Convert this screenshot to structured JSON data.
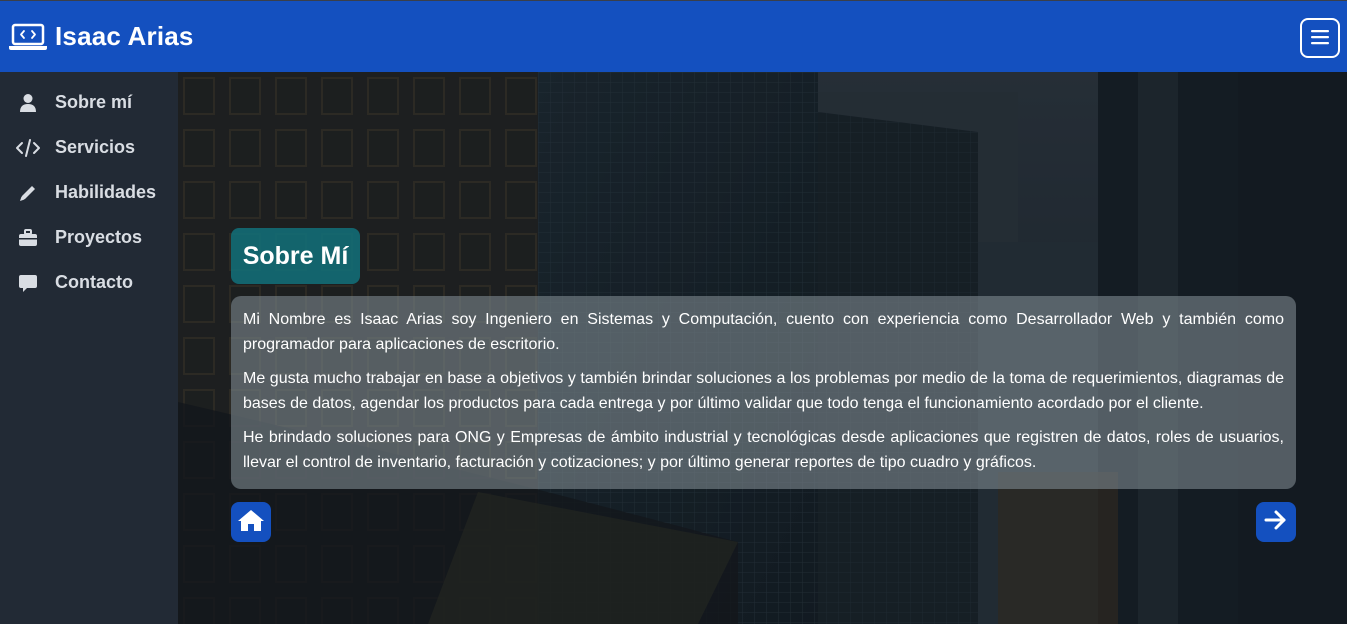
{
  "header": {
    "brand": "Isaac Arias",
    "brand_icon": "laptop-code-icon",
    "menu_icon": "hamburger-menu-icon"
  },
  "sidebar": {
    "items": [
      {
        "label": "Sobre mí",
        "icon": "user-icon"
      },
      {
        "label": "Servicios",
        "icon": "code-icon"
      },
      {
        "label": "Habilidades",
        "icon": "pencil-icon"
      },
      {
        "label": "Proyectos",
        "icon": "briefcase-icon"
      },
      {
        "label": "Contacto",
        "icon": "comment-icon"
      }
    ]
  },
  "main": {
    "title": "Sobre Mí",
    "paragraphs": [
      "Mi Nombre es Isaac Arias soy Ingeniero en Sistemas y Computación, cuento con experiencia como Desarrollador Web y también como programador para aplicaciones de escritorio.",
      "Me gusta mucho trabajar en base a objetivos y también brindar soluciones a los problemas por medio de la toma de requerimientos, diagramas de bases de datos, agendar los productos para cada entrega y por último validar que todo tenga el funcionamiento acordado por el cliente.",
      "He brindado soluciones para ONG y Empresas de ámbito industrial y tecnológicas desde aplicaciones que registren de datos, roles de usuarios, llevar el control de inventario, facturación y cotizaciones; y por último generar reportes de tipo cuadro y gráficos."
    ],
    "home_icon": "home-icon",
    "next_icon": "arrow-right-icon"
  },
  "colors": {
    "header_bg": "#1450bf",
    "sidebar_bg": "#222a35",
    "title_bg": "#126e78",
    "button_bg": "#1450bf"
  }
}
